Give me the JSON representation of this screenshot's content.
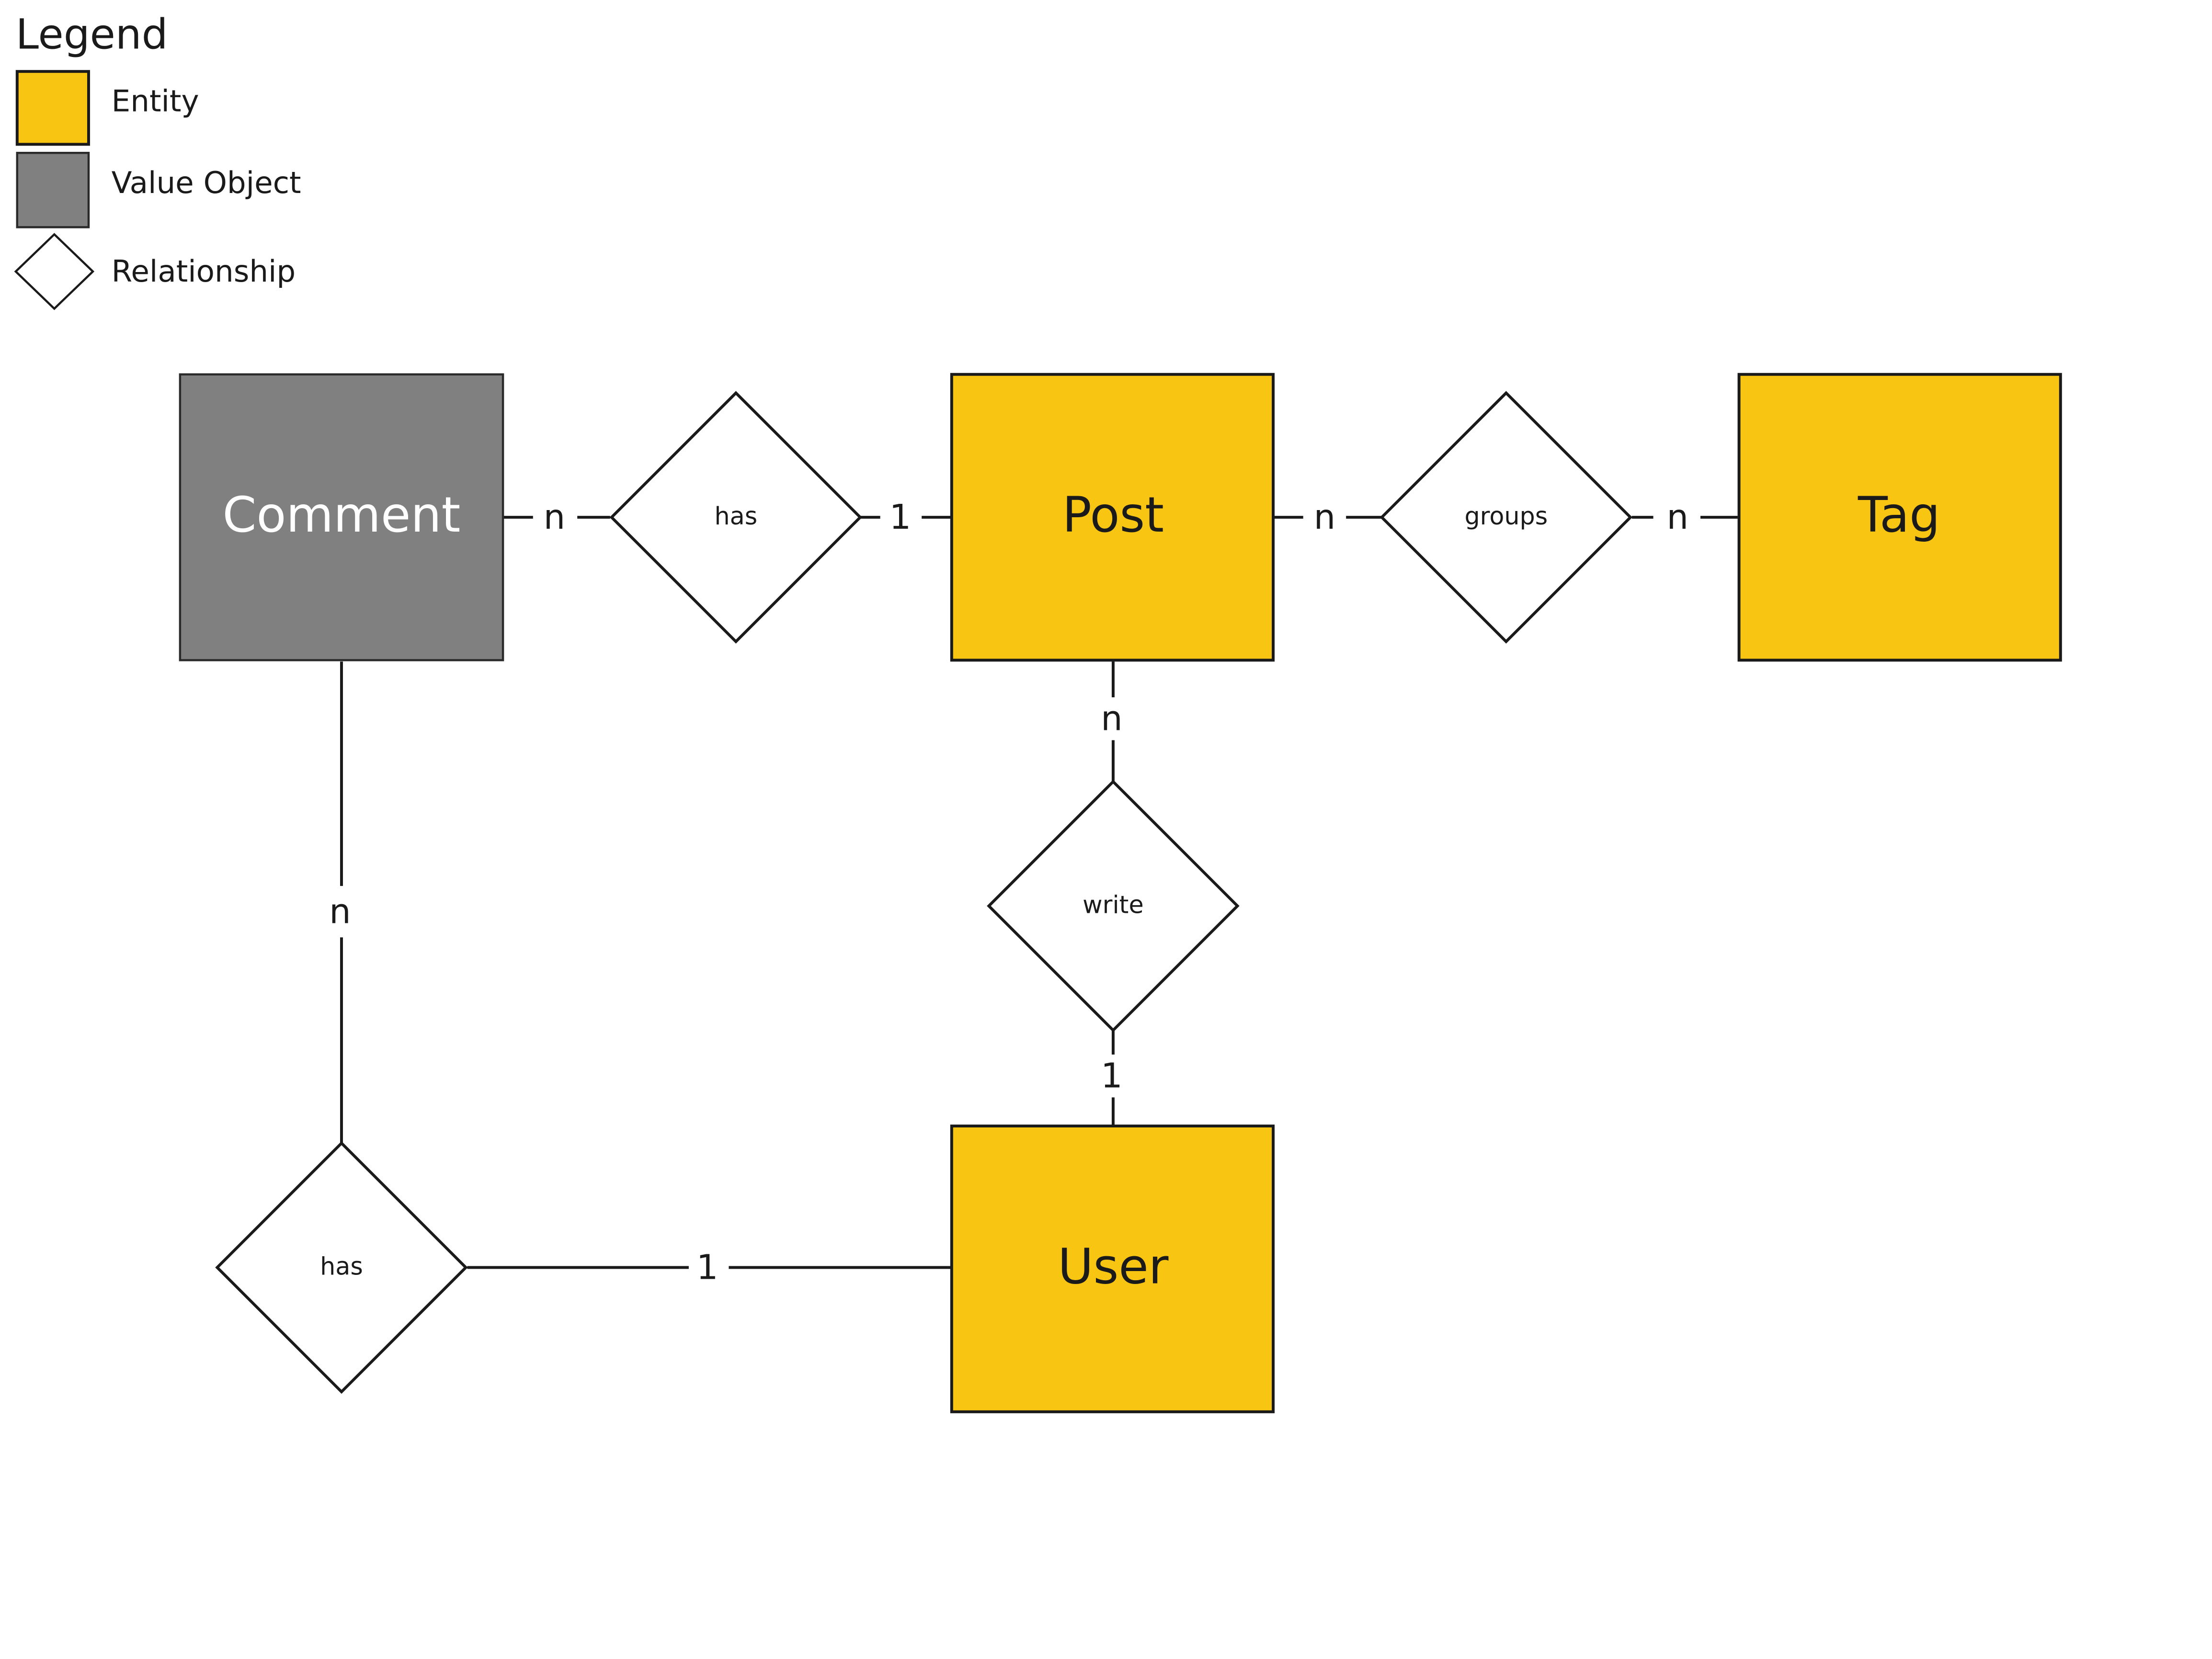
{
  "legend": {
    "title": "Legend",
    "items": [
      {
        "label": "Entity",
        "kind": "entity",
        "color": "#F8C512"
      },
      {
        "label": "Value Object",
        "kind": "value-object",
        "color": "#808080"
      },
      {
        "label": "Relationship",
        "kind": "relationship",
        "color": "#FFFFFF"
      }
    ]
  },
  "nodes": {
    "comment": {
      "label": "Comment",
      "kind": "value-object"
    },
    "post": {
      "label": "Post",
      "kind": "entity"
    },
    "tag": {
      "label": "Tag",
      "kind": "entity"
    },
    "user": {
      "label": "User",
      "kind": "entity"
    },
    "rel_has_top": {
      "label": "has",
      "kind": "relationship"
    },
    "rel_groups": {
      "label": "groups",
      "kind": "relationship"
    },
    "rel_write": {
      "label": "write",
      "kind": "relationship"
    },
    "rel_has_bottom": {
      "label": "has",
      "kind": "relationship"
    }
  },
  "cardinalities": {
    "comment_has": "n",
    "has_post": "1",
    "post_groups": "n",
    "groups_tag": "n",
    "post_write": "n",
    "write_user": "1",
    "comment_has_bottom": "n",
    "has_bottom_user": "1"
  },
  "colors": {
    "entity": "#F8C512",
    "value_object": "#808080",
    "relationship": "#FFFFFF",
    "stroke": "#1A1A1A"
  }
}
